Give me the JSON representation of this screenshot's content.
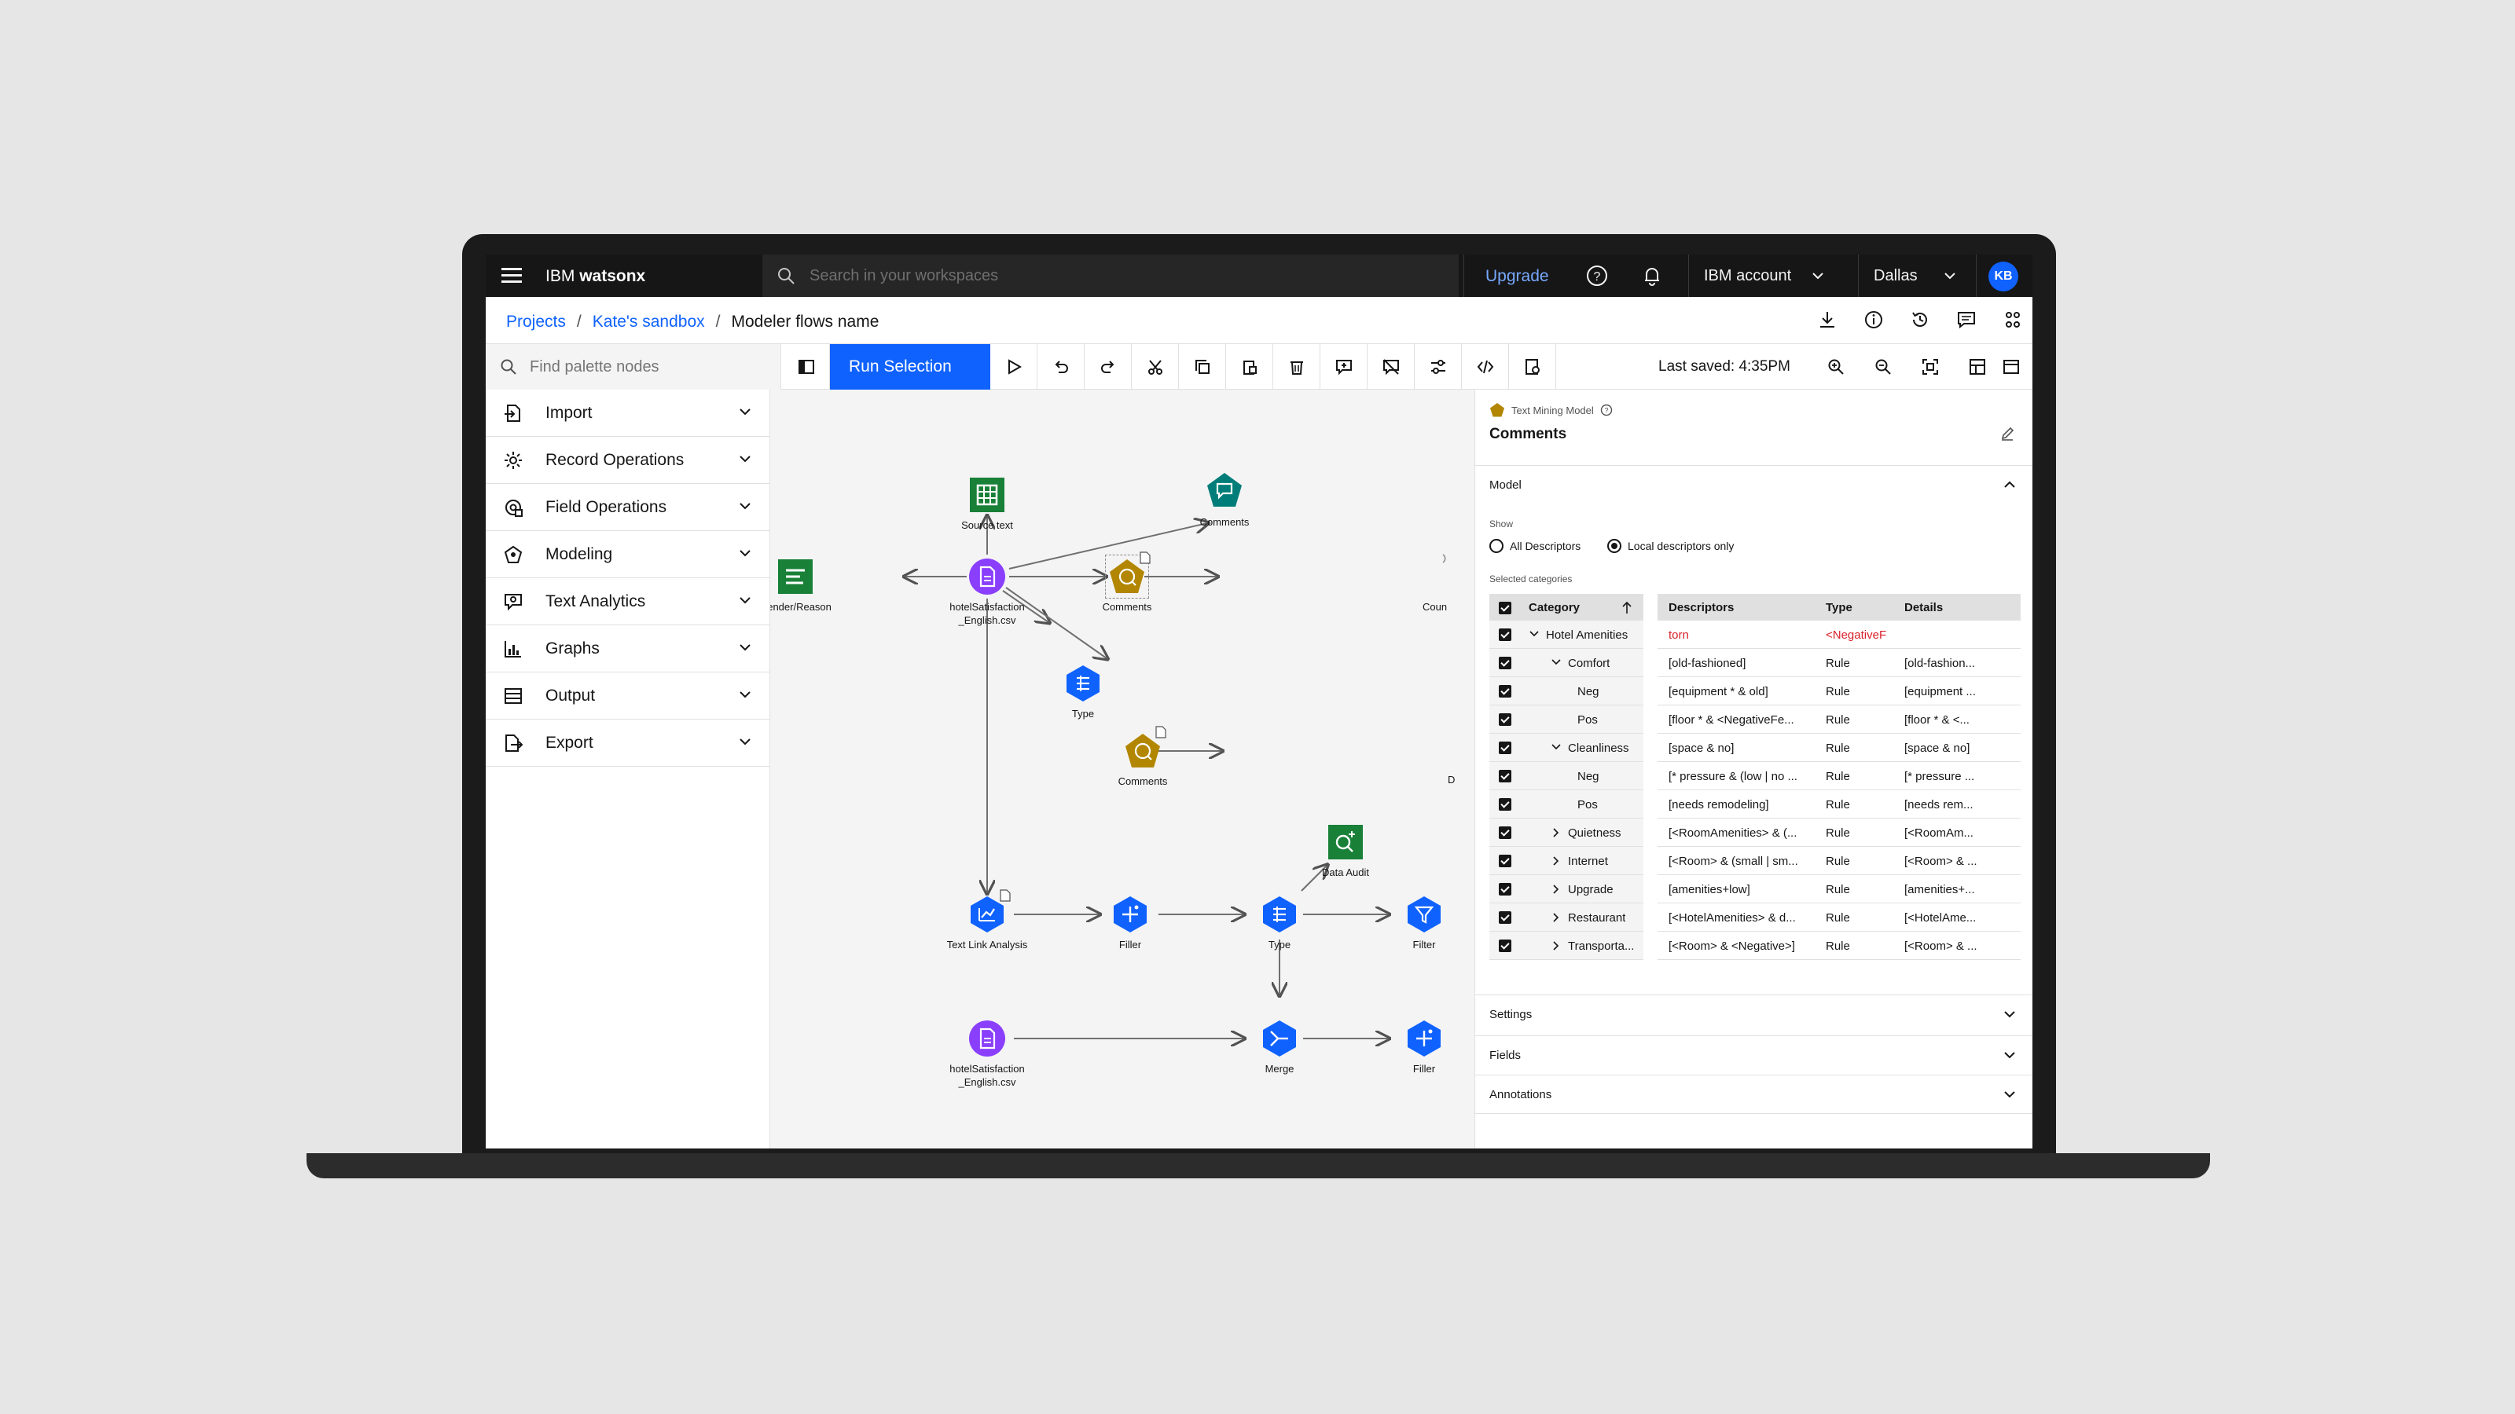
{
  "topbar": {
    "brand_prefix": "IBM",
    "brand_name": "watsonx",
    "search_placeholder": "Search in your workspaces",
    "upgrade": "Upgrade",
    "account": "IBM account",
    "region": "Dallas",
    "avatar_initials": "KB"
  },
  "breadcrumb": {
    "projects": "Projects",
    "sandbox": "Kate's sandbox",
    "current": "Modeler flows name",
    "separator": "/"
  },
  "toolbar": {
    "palette_search_placeholder": "Find palette nodes",
    "run_selection": "Run Selection",
    "last_saved": "Last saved: 4:35PM"
  },
  "palette": {
    "items": [
      {
        "label": "Import",
        "icon": "import-icon"
      },
      {
        "label": "Record Operations",
        "icon": "record-operations-icon"
      },
      {
        "label": "Field Operations",
        "icon": "field-operations-icon"
      },
      {
        "label": "Modeling",
        "icon": "modeling-icon"
      },
      {
        "label": "Text Analytics",
        "icon": "text-analytics-icon"
      },
      {
        "label": "Graphs",
        "icon": "graphs-icon"
      },
      {
        "label": "Output",
        "icon": "output-icon"
      },
      {
        "label": "Export",
        "icon": "export-icon"
      }
    ]
  },
  "canvas": {
    "nodes": {
      "source_text": "Source text",
      "gender_reason": "Gender/Reason",
      "hotel_csv_1a": "hotelSatisfaction",
      "hotel_csv_1b": "_English.csv",
      "comments_top": "Comments",
      "comments_mid": "Comments",
      "comments_selected": "Comments",
      "count_partial": "Coun",
      "type_1": "Type",
      "d_partial": "D",
      "data_audit": "Data Audit",
      "text_link_analysis": "Text Link Analysis",
      "filler_1": "Filler",
      "type_2": "Type",
      "filter_1": "Filter",
      "hotel_csv_2a": "hotelSatisfaction",
      "hotel_csv_2b": "_English.csv",
      "merge": "Merge",
      "filler_2": "Filler"
    }
  },
  "properties": {
    "node_type": "Text Mining Model",
    "title": "Comments",
    "model_section": "Model",
    "show_label": "Show",
    "radio_all": "All Descriptors",
    "radio_local": "Local descriptors only",
    "selected_categories": "Selected categories",
    "cat_header": "Category",
    "desc_headers": {
      "descriptors": "Descriptors",
      "type": "Type",
      "details": "Details"
    },
    "categories": [
      {
        "label": "Hotel Amenities",
        "indent": 0,
        "toggle": "expanded"
      },
      {
        "label": "Comfort",
        "indent": 1,
        "toggle": "expanded"
      },
      {
        "label": "Neg",
        "indent": 2,
        "toggle": "none"
      },
      {
        "label": "Pos",
        "indent": 2,
        "toggle": "none"
      },
      {
        "label": "Cleanliness",
        "indent": 1,
        "toggle": "expanded"
      },
      {
        "label": "Neg",
        "indent": 2,
        "toggle": "none"
      },
      {
        "label": "Pos",
        "indent": 2,
        "toggle": "none"
      },
      {
        "label": "Quietness",
        "indent": 1,
        "toggle": "collapsed"
      },
      {
        "label": "Internet",
        "indent": 1,
        "toggle": "collapsed"
      },
      {
        "label": "Upgrade",
        "indent": 1,
        "toggle": "collapsed"
      },
      {
        "label": "Restaurant",
        "indent": 1,
        "toggle": "collapsed"
      },
      {
        "label": "Transporta...",
        "indent": 1,
        "toggle": "collapsed"
      }
    ],
    "descriptors": [
      {
        "descriptor": "torn",
        "type": "<NegativeF",
        "details": "",
        "highlight": true
      },
      {
        "descriptor": "[old-fashioned]",
        "type": "Rule",
        "details": "[old-fashion..."
      },
      {
        "descriptor": "[equipment * & old]",
        "type": "Rule",
        "details": "[equipment ..."
      },
      {
        "descriptor": "[floor * & <NegativeFe...",
        "type": "Rule",
        "details": "[floor * & <..."
      },
      {
        "descriptor": "[space & no]",
        "type": "Rule",
        "details": "[space & no]"
      },
      {
        "descriptor": "[* pressure & (low | no ...",
        "type": "Rule",
        "details": "[* pressure ..."
      },
      {
        "descriptor": "[needs remodeling]",
        "type": "Rule",
        "details": "[needs rem..."
      },
      {
        "descriptor": "[<RoomAmenities> & (...",
        "type": "Rule",
        "details": "[<RoomAm..."
      },
      {
        "descriptor": "[<Room> & (small | sm...",
        "type": "Rule",
        "details": "[<Room> & ..."
      },
      {
        "descriptor": "[amenities+low]",
        "type": "Rule",
        "details": "[amenities+..."
      },
      {
        "descriptor": "[<HotelAmenities> & d...",
        "type": "Rule",
        "details": "[<HotelAme..."
      },
      {
        "descriptor": "[<Room> & <Negative>]",
        "type": "Rule",
        "details": "[<Room> & ..."
      }
    ],
    "settings_section": "Settings",
    "fields_section": "Fields",
    "annotations_section": "Annotations"
  },
  "colors": {
    "accent": "#0f62fe",
    "link": "#78a9ff",
    "node_green": "#198038",
    "node_purple": "#8a3ffc",
    "node_blue": "#0f62fe",
    "node_teal": "#007d79",
    "node_gold": "#b28600",
    "highlight_red": "#da1e28"
  }
}
